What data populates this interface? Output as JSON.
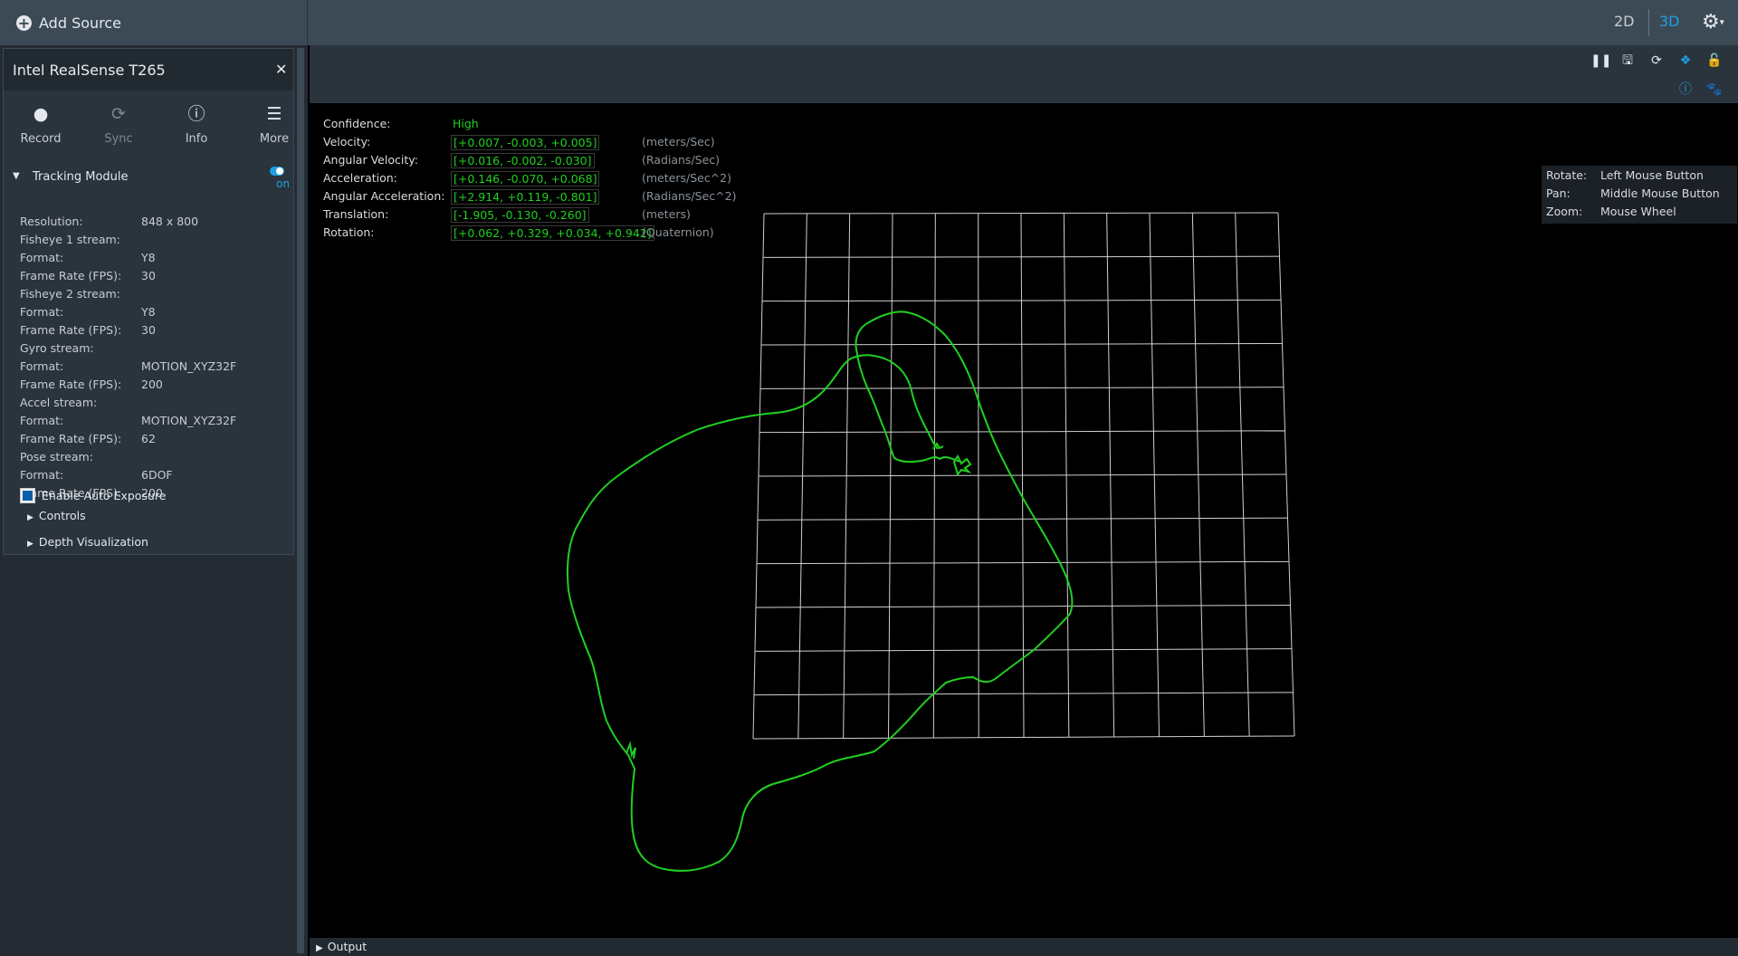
{
  "topbar": {
    "add_source_label": "Add Source",
    "view_2d": "2D",
    "view_3d": "3D"
  },
  "device": {
    "title": "Intel RealSense T265",
    "buttons": {
      "record": "Record",
      "sync": "Sync",
      "info": "Info",
      "more": "More"
    },
    "module": {
      "name": "Tracking Module",
      "state": "on"
    },
    "properties": [
      {
        "key": "Resolution:",
        "value": "848 x 800"
      },
      {
        "key": "Fisheye 1 stream:",
        "value": ""
      },
      {
        "key": "Format:",
        "value": "Y8"
      },
      {
        "key": "Frame Rate (FPS):",
        "value": "30"
      },
      {
        "key": "Fisheye 2 stream:",
        "value": ""
      },
      {
        "key": "Format:",
        "value": "Y8"
      },
      {
        "key": "Frame Rate (FPS):",
        "value": "30"
      },
      {
        "key": "Gyro stream:",
        "value": ""
      },
      {
        "key": "Format:",
        "value": "MOTION_XYZ32F"
      },
      {
        "key": "Frame Rate (FPS):",
        "value": "200"
      },
      {
        "key": "Accel stream:",
        "value": ""
      },
      {
        "key": "Format:",
        "value": "MOTION_XYZ32F"
      },
      {
        "key": "Frame Rate (FPS):",
        "value": "62"
      },
      {
        "key": "Pose stream:",
        "value": ""
      },
      {
        "key": "Format:",
        "value": "6DOF"
      },
      {
        "key": "Frame Rate (FPS):",
        "value": "200"
      }
    ],
    "auto_exposure_label": "Enable Auto Exposure",
    "controls_label": "Controls",
    "depth_vis_label": "Depth Visualization"
  },
  "telemetry": [
    {
      "label": "Confidence:",
      "value": "High",
      "unit": ""
    },
    {
      "label": "Velocity:",
      "value": "[+0.007, -0.003, +0.005]",
      "unit": "(meters/Sec)"
    },
    {
      "label": "Angular Velocity:",
      "value": "[+0.016, -0.002, -0.030]",
      "unit": "(Radians/Sec)"
    },
    {
      "label": "Acceleration:",
      "value": "[+0.146, -0.070, +0.068]",
      "unit": "(meters/Sec^2)"
    },
    {
      "label": "Angular Acceleration:",
      "value": "[+2.914, +0.119, -0.801]",
      "unit": "(Radians/Sec^2)"
    },
    {
      "label": "Translation:",
      "value": "[-1.905, -0.130, -0.260]",
      "unit": "(meters)"
    },
    {
      "label": "Rotation:",
      "value": "[+0.062, +0.329, +0.034, +0.942]",
      "unit": "(Quaternion)"
    }
  ],
  "help": [
    {
      "key": "Rotate:",
      "value": "Left Mouse Button"
    },
    {
      "key": "Pan:",
      "value": "Middle Mouse Button"
    },
    {
      "key": "Zoom:",
      "value": "Mouse Wheel"
    }
  ],
  "output_label": "Output",
  "colors": {
    "accent": "#1e9fe0",
    "trajectory": "#20d020",
    "grid": "#d0d0d0"
  }
}
